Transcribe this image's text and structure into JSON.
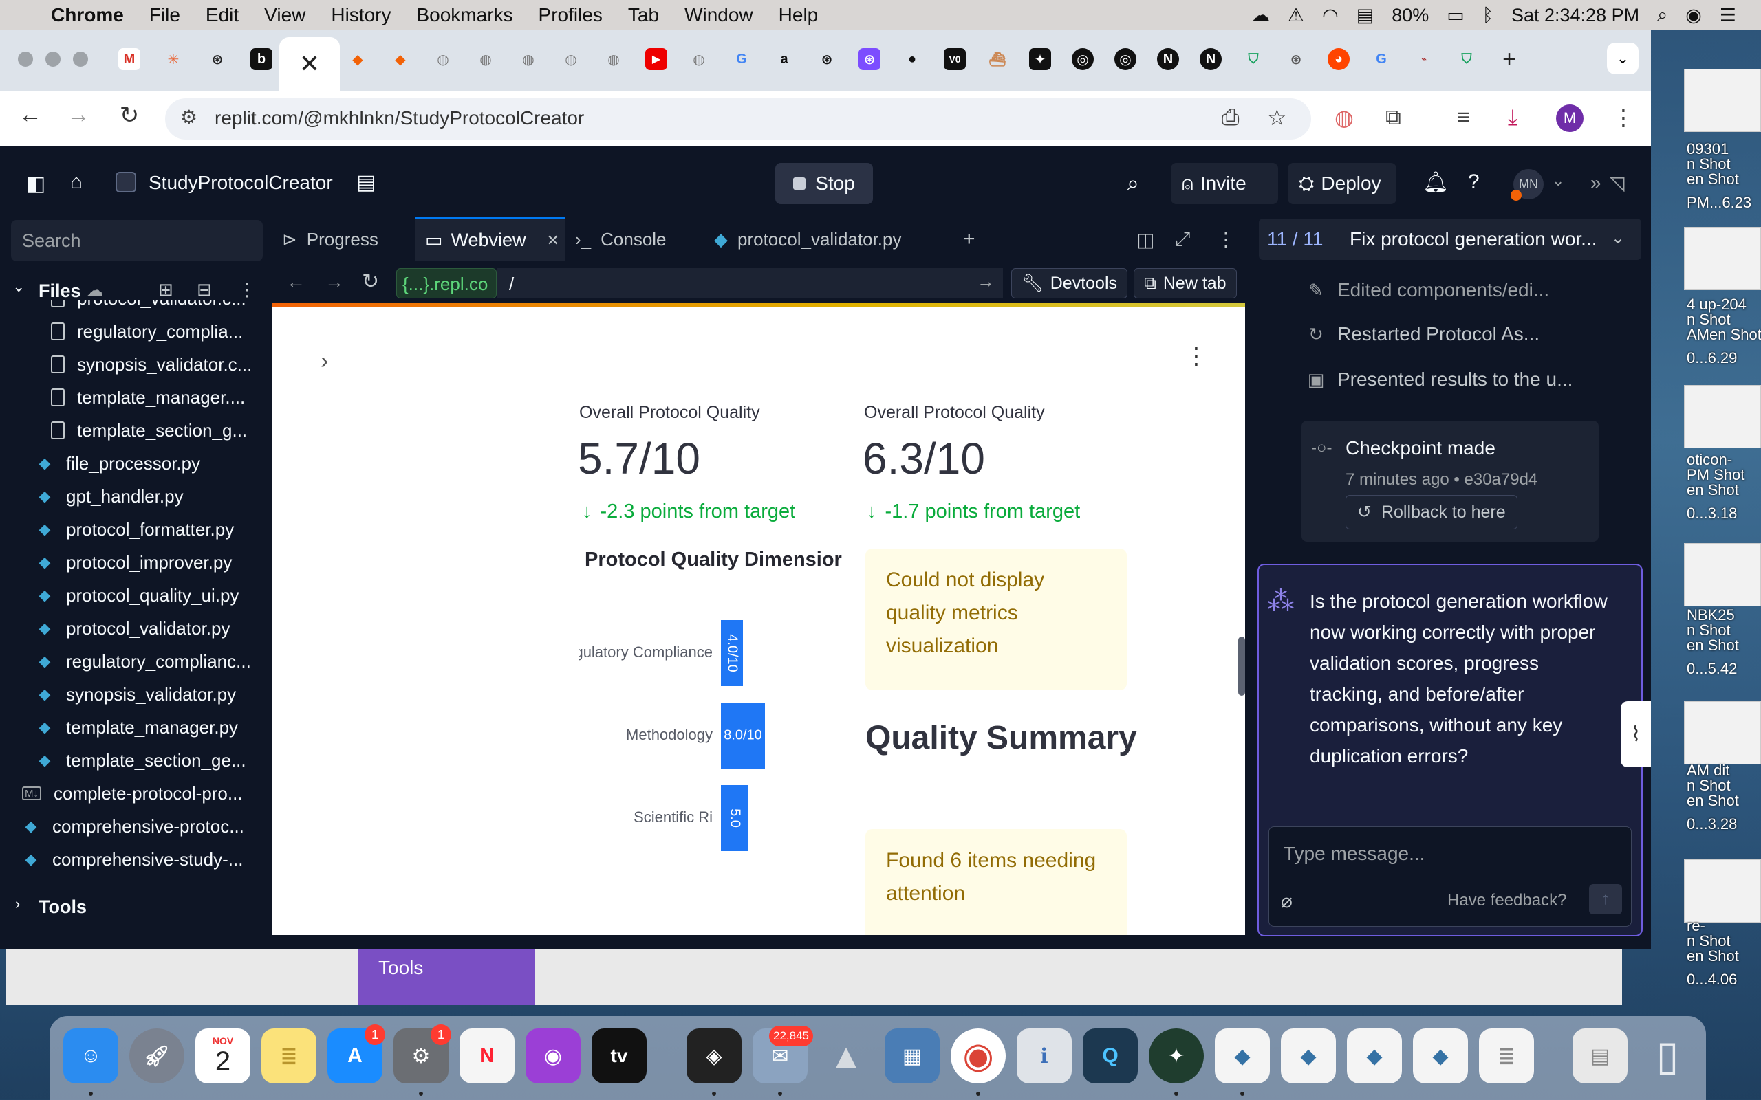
{
  "menubar": {
    "app": "Chrome",
    "items": [
      "File",
      "Edit",
      "View",
      "History",
      "Bookmarks",
      "Profiles",
      "Tab",
      "Window",
      "Help"
    ],
    "battery": "80%",
    "clock": "Sat 2:34:28 PM"
  },
  "browser": {
    "url": "replit.com/@mkhlnkn/StudyProtocolCreator",
    "profile_initial": "M"
  },
  "replit": {
    "project_name": "StudyProtocolCreator",
    "stop_label": "Stop",
    "invite_label": "Invite",
    "deploy_label": "Deploy",
    "avatar_initials": "MN",
    "search_placeholder": "Search",
    "files_label": "Files",
    "tools_label": "Tools",
    "files": [
      {
        "name": "protocol_validator.c...",
        "type": "doc"
      },
      {
        "name": "regulatory_complia...",
        "type": "doc"
      },
      {
        "name": "synopsis_validator.c...",
        "type": "doc"
      },
      {
        "name": "template_manager....",
        "type": "doc"
      },
      {
        "name": "template_section_g...",
        "type": "doc"
      },
      {
        "name": "file_processor.py",
        "type": "py"
      },
      {
        "name": "gpt_handler.py",
        "type": "py"
      },
      {
        "name": "protocol_formatter.py",
        "type": "py"
      },
      {
        "name": "protocol_improver.py",
        "type": "py"
      },
      {
        "name": "protocol_quality_ui.py",
        "type": "py"
      },
      {
        "name": "protocol_validator.py",
        "type": "py"
      },
      {
        "name": "regulatory_complianc...",
        "type": "py"
      },
      {
        "name": "synopsis_validator.py",
        "type": "py"
      },
      {
        "name": "template_manager.py",
        "type": "py"
      },
      {
        "name": "template_section_ge...",
        "type": "py"
      },
      {
        "name": "complete-protocol-pro...",
        "type": "md"
      },
      {
        "name": "comprehensive-protoc...",
        "type": "py"
      },
      {
        "name": "comprehensive-study-...",
        "type": "py"
      }
    ],
    "tabs": {
      "progress": "Progress",
      "webview": "Webview",
      "console": "Console",
      "file": "protocol_validator.py"
    },
    "webview": {
      "url_chip": "{...}.repl.co",
      "path": "/",
      "devtools": "Devtools",
      "new_tab": "New tab"
    }
  },
  "app_content": {
    "metric_left": {
      "label": "Overall Protocol Quality",
      "value": "5.7/10",
      "delta": "-2.3 points from target"
    },
    "metric_right": {
      "label": "Overall Protocol Quality",
      "value": "6.3/10",
      "delta": "-1.7 points from target"
    },
    "dimensions_title": "Protocol Quality Dimensior",
    "bars": [
      {
        "label": "gulatory Compliance",
        "value": 4.0,
        "text": "4.0/10"
      },
      {
        "label": "Methodology",
        "value": 8.0,
        "text": "8.0/10"
      },
      {
        "label": "Scientific Ri",
        "value": 5.0,
        "text": "5.0"
      }
    ],
    "warning_1": "Could not display quality metrics visualization",
    "summary_title": "Quality Summary",
    "warning_2": "Found 6 items needing attention"
  },
  "agent": {
    "task_counter": "11 / 11",
    "task_title": "Fix protocol generation wor...",
    "steps": [
      {
        "icon": "edit-icon",
        "text": "Edited components/edi..."
      },
      {
        "icon": "restart-icon",
        "text": "Restarted Protocol As..."
      },
      {
        "icon": "present-icon",
        "text": "Presented results to the u..."
      }
    ],
    "checkpoint_title": "Checkpoint made",
    "checkpoint_meta": "7 minutes ago • e30a79d4",
    "rollback_label": "Rollback to here",
    "question": "Is the protocol generation workflow now working correctly with proper validation scores, progress tracking, and before/after comparisons, without any key duplication errors?",
    "input_placeholder": "Type message...",
    "feedback_label": "Have feedback?"
  },
  "desktop": {
    "thumb_labels": [
      "09301",
      "n Shot",
      "en Shot",
      "PM...6.23",
      "4 up-204",
      "n Shot",
      "AMen Shot",
      "0...6.29",
      "oticon-",
      "PM Shot",
      "en Shot",
      "0...3.18",
      "NBK25",
      "n Shot",
      "en Shot",
      "0...5.42",
      "AM dit",
      "n Shot",
      "en Shot",
      "0...3.28",
      "re-",
      "n Shot",
      "en Shot",
      "0...4.06"
    ],
    "behind_tools": "Tools"
  },
  "dock": {
    "mail_badge": "22,845",
    "appstore_badge": "1",
    "settings_badge": "1",
    "calendar_month": "NOV",
    "calendar_day": "2"
  }
}
